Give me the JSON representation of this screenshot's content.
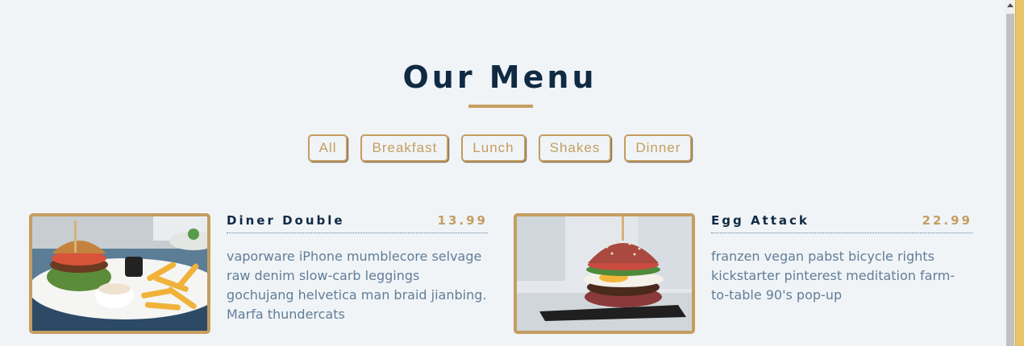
{
  "menu": {
    "title": "Our Menu",
    "accent_color": "#c59d5f",
    "title_color": "#102a43",
    "filters": [
      "All",
      "Breakfast",
      "Lunch",
      "Shakes",
      "Dinner"
    ],
    "items": [
      {
        "name": "Diner Double",
        "price": "13.99",
        "description": "vaporware iPhone mumblecore selvage raw denim slow-carb leggings gochujang helvetica man braid jianbing. Marfa thundercats",
        "image": "burger-with-fries-photo"
      },
      {
        "name": "Egg Attack",
        "price": "22.99",
        "description": "franzen vegan pabst bicycle rights kickstarter pinterest meditation farm-to-table 90's pop-up",
        "image": "egg-burger-photo"
      }
    ]
  }
}
